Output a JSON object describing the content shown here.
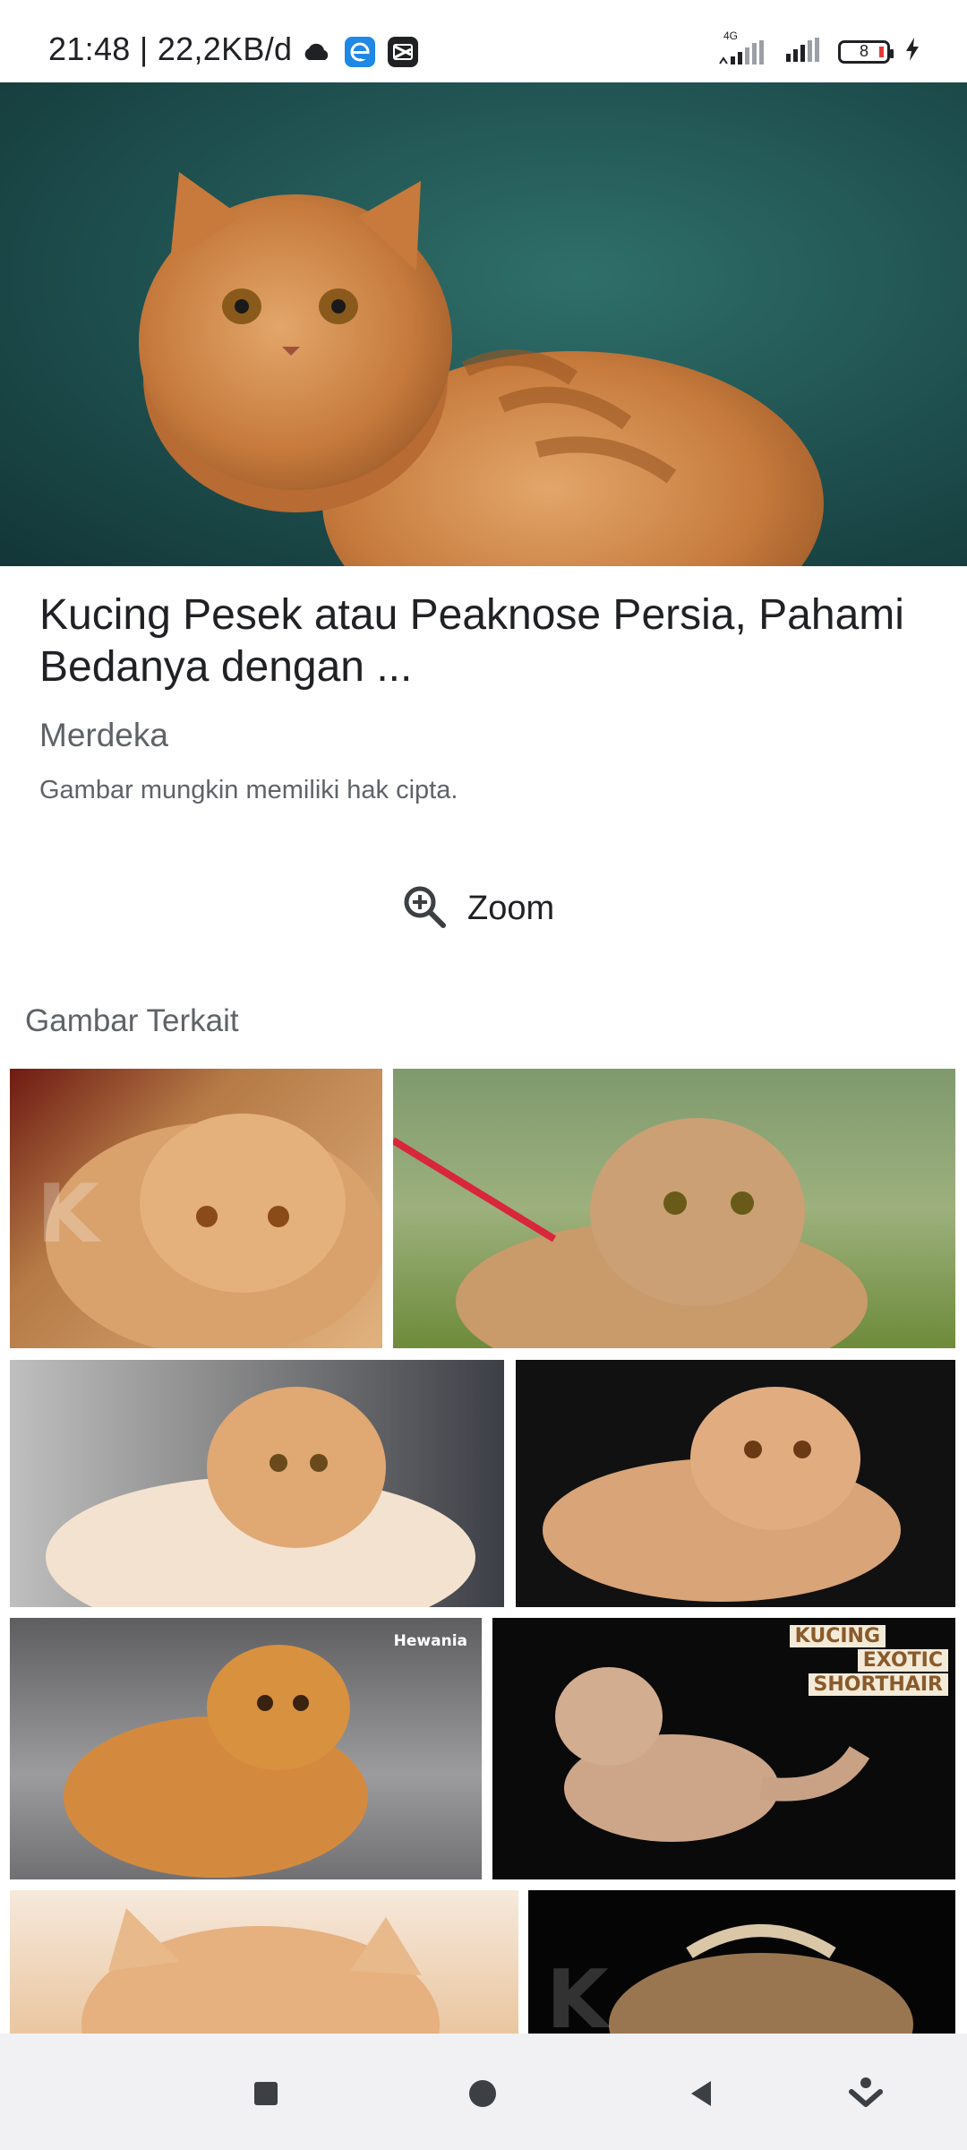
{
  "status_bar": {
    "time": "21:48 | 22,2KB/d",
    "network_label": "4G",
    "battery": "8"
  },
  "result": {
    "title": "Kucing Pesek atau Peaknose Persia, Pahami Bedanya dengan ...",
    "source": "Merdeka",
    "copyright_notice": "Gambar mungkin memiliki hak cipta."
  },
  "zoom": {
    "label": "Zoom"
  },
  "related": {
    "heading": "Gambar Terkait",
    "thumbs": [
      {
        "watermark": "K"
      },
      {
        "watermark": ""
      },
      {
        "watermark": ""
      },
      {
        "watermark": ""
      },
      {
        "watermark": "Hewania"
      },
      {
        "overlay_lines": [
          "KUCING",
          "EXOTIC",
          "SHORTHAIR"
        ]
      },
      {
        "watermark": ""
      },
      {
        "watermark": "K"
      }
    ]
  },
  "colors": {
    "accent_status_icon": "#1e88e5",
    "low_battery": "#e53935"
  }
}
